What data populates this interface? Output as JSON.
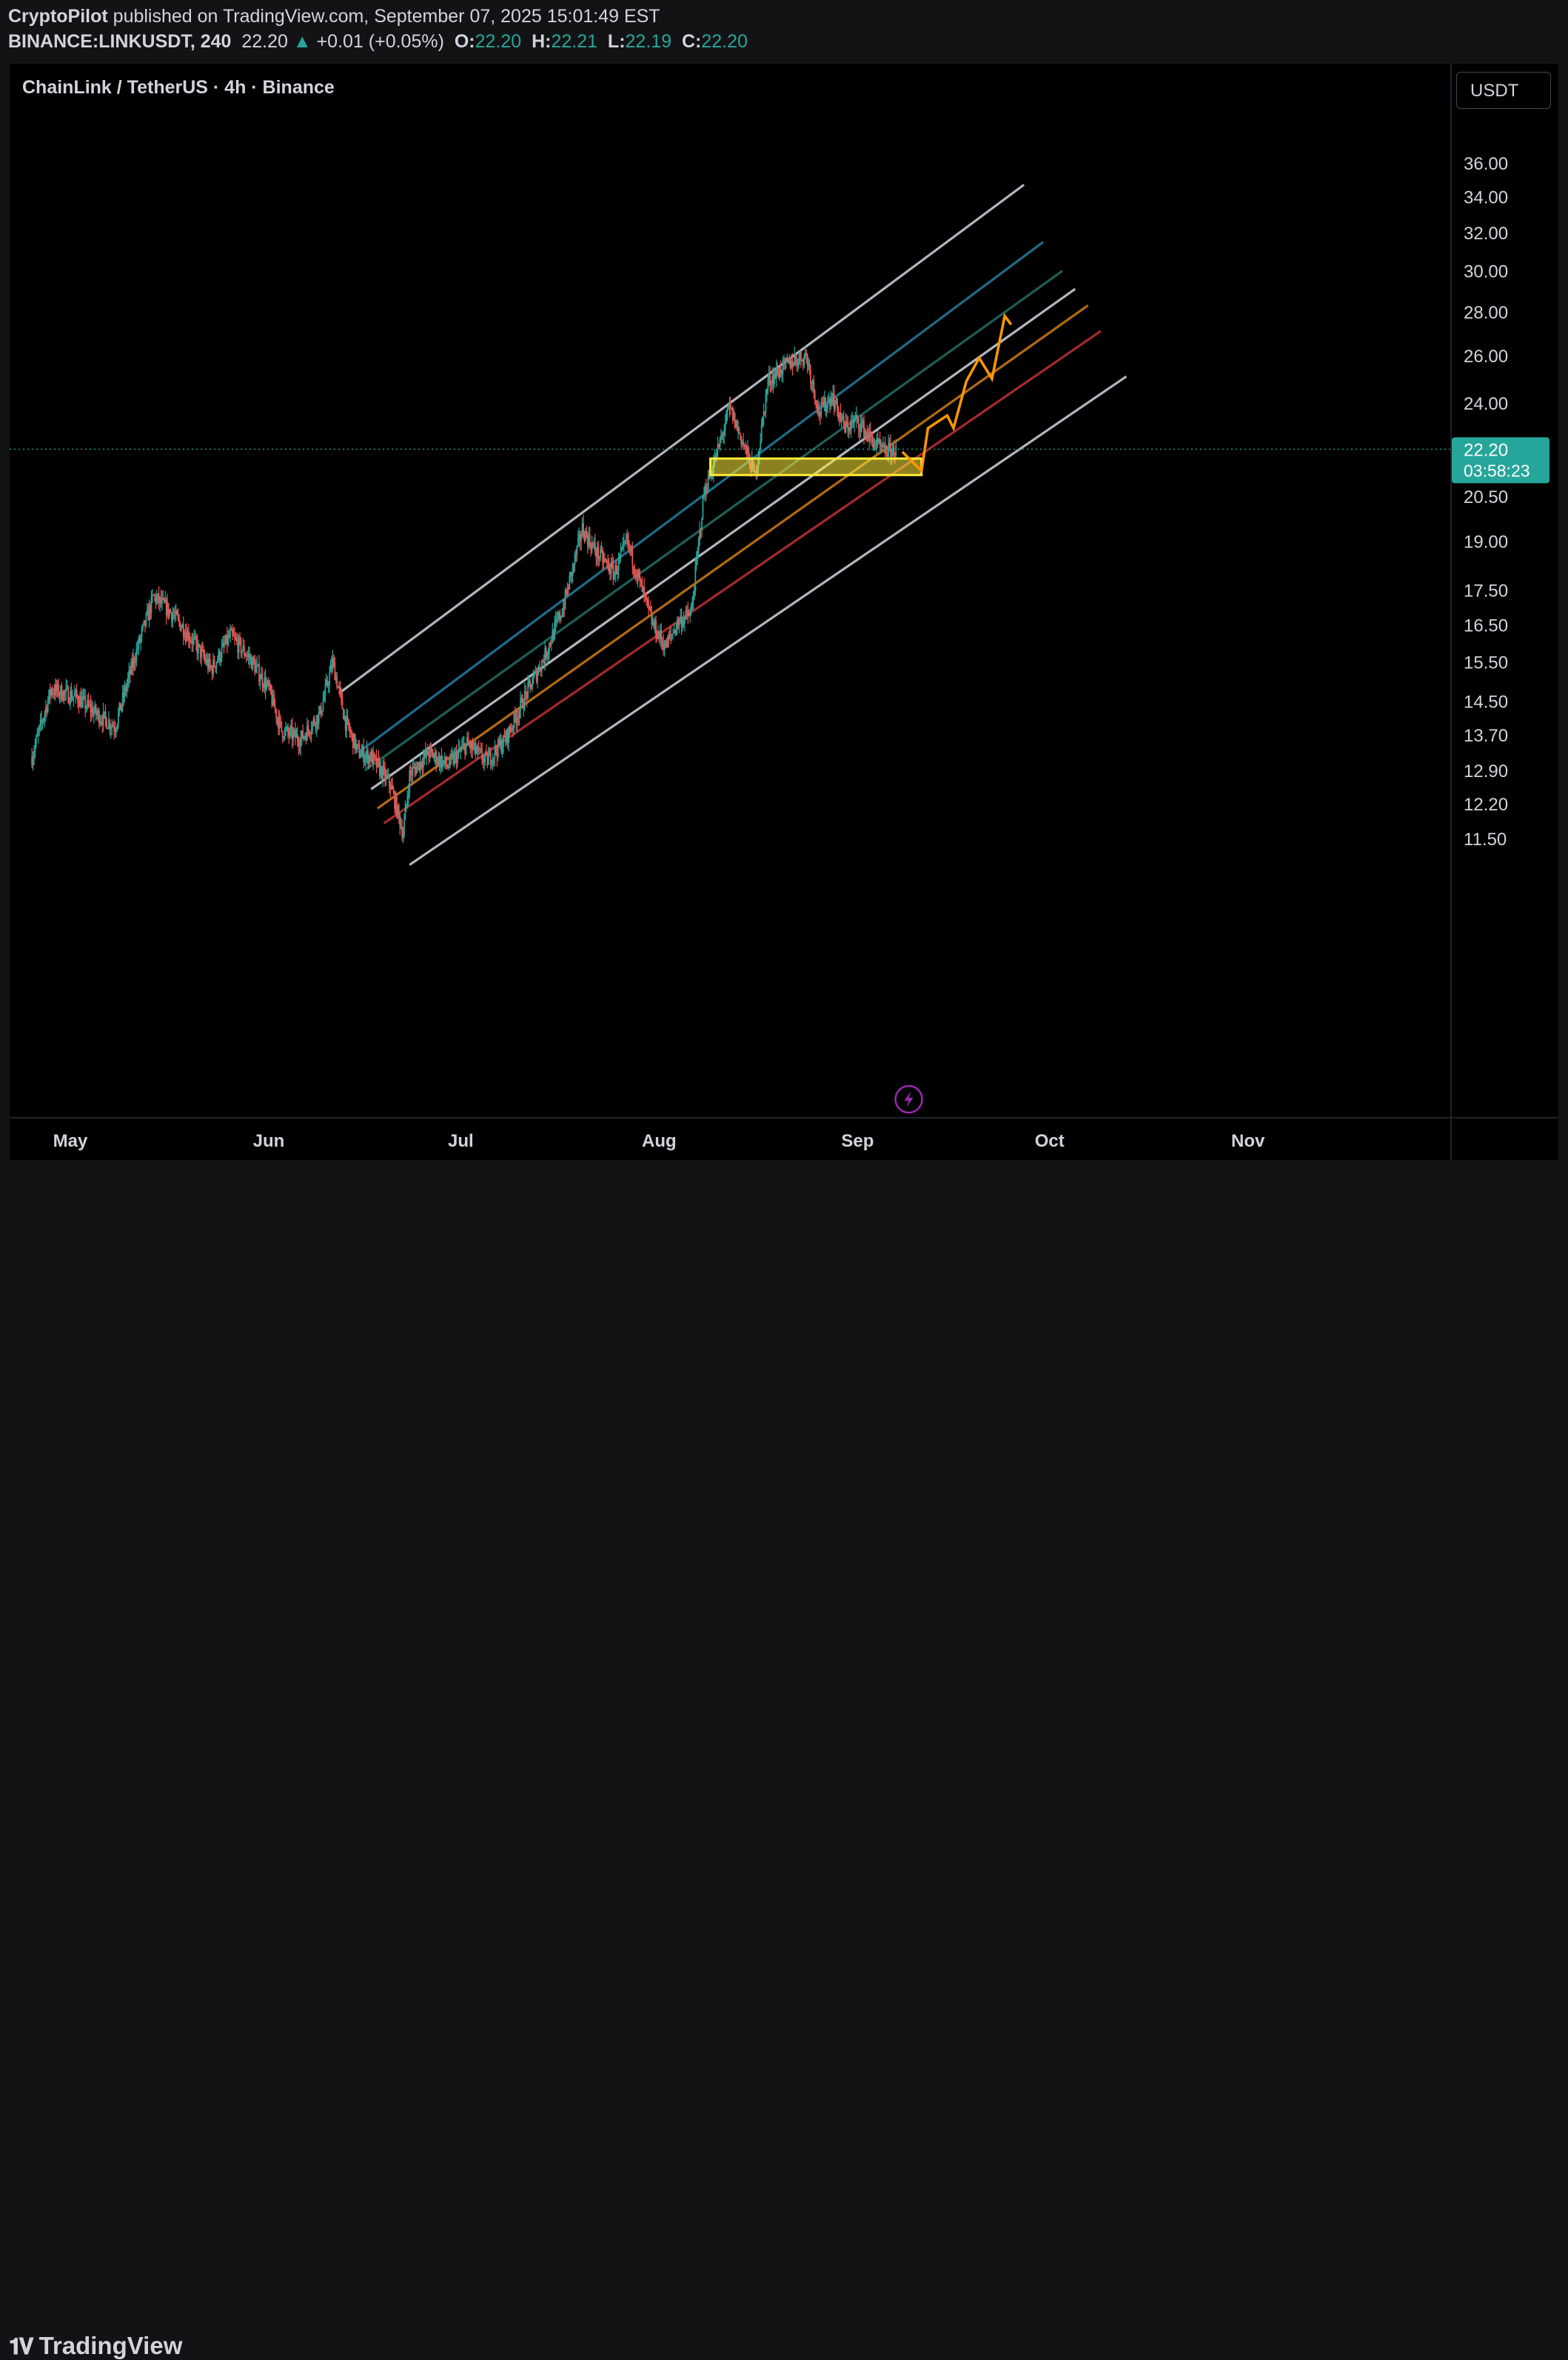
{
  "header": {
    "author": "CryptoPilot",
    "published_text": " published on TradingView.com, September 07, 2025 15:01:49 EST",
    "symbol": "BINANCE:LINKUSDT, 240",
    "last": "22.20",
    "change": "+0.01 (+0.05%)",
    "o_label": "O:",
    "o_value": "22.20",
    "h_label": "H:",
    "h_value": "22.21",
    "l_label": "L:",
    "l_value": "22.19",
    "c_label": "C:",
    "c_value": "22.20"
  },
  "chart_title": "ChainLink / TetherUS · 4h · Binance",
  "currency_button": "USDT",
  "price_badge": {
    "price": "22.20",
    "countdown": "03:58:23"
  },
  "footer": {
    "brand": "TradingView"
  },
  "colors": {
    "up": "#26a69a",
    "down": "#ef5350",
    "background": "#000000",
    "channel_outer": "#b2b5be",
    "channel_blue": "#1f6b8a",
    "channel_teal": "#1e5e58",
    "channel_orange": "#b26b12",
    "channel_red": "#a52a2a",
    "projection": "#ff9800",
    "zone": "#ffeb3b"
  },
  "chart_data": {
    "type": "candlestick",
    "title": "ChainLink / TetherUS · 4h · Binance",
    "interval": "4h",
    "y_scale": "log",
    "y_ticks": [
      "36.00",
      "34.00",
      "32.00",
      "30.00",
      "28.00",
      "26.00",
      "24.00",
      "20.50",
      "19.00",
      "17.50",
      "16.50",
      "15.50",
      "14.50",
      "13.70",
      "12.90",
      "12.20",
      "11.50"
    ],
    "x_ticks": [
      "May",
      "Jun",
      "Jul",
      "Aug",
      "Sep",
      "Oct",
      "Nov"
    ],
    "last_price": 22.2,
    "close_path": [
      [
        "2025-04-25",
        13.2
      ],
      [
        "2025-04-28",
        14.8
      ],
      [
        "2025-05-02",
        14.6
      ],
      [
        "2025-05-05",
        14.2
      ],
      [
        "2025-05-08",
        13.9
      ],
      [
        "2025-05-11",
        15.6
      ],
      [
        "2025-05-14",
        17.3
      ],
      [
        "2025-05-17",
        16.8
      ],
      [
        "2025-05-20",
        16.1
      ],
      [
        "2025-05-23",
        15.3
      ],
      [
        "2025-05-26",
        16.2
      ],
      [
        "2025-05-29",
        15.6
      ],
      [
        "2025-06-01",
        14.8
      ],
      [
        "2025-06-03",
        13.8
      ],
      [
        "2025-06-06",
        13.6
      ],
      [
        "2025-06-09",
        14.2
      ],
      [
        "2025-06-11",
        15.5
      ],
      [
        "2025-06-13",
        14.0
      ],
      [
        "2025-06-15",
        13.3
      ],
      [
        "2025-06-17",
        13.2
      ],
      [
        "2025-06-20",
        12.6
      ],
      [
        "2025-06-22",
        11.6
      ],
      [
        "2025-06-23",
        12.8
      ],
      [
        "2025-06-26",
        13.3
      ],
      [
        "2025-06-29",
        13.0
      ],
      [
        "2025-07-02",
        13.5
      ],
      [
        "2025-07-05",
        13.1
      ],
      [
        "2025-07-08",
        13.6
      ],
      [
        "2025-07-11",
        14.6
      ],
      [
        "2025-07-14",
        15.6
      ],
      [
        "2025-07-17",
        17.0
      ],
      [
        "2025-07-20",
        19.4
      ],
      [
        "2025-07-22",
        18.7
      ],
      [
        "2025-07-25",
        18.0
      ],
      [
        "2025-07-27",
        19.0
      ],
      [
        "2025-07-29",
        17.7
      ],
      [
        "2025-07-31",
        16.5
      ],
      [
        "2025-08-02",
        15.9
      ],
      [
        "2025-08-04",
        16.6
      ],
      [
        "2025-08-06",
        16.8
      ],
      [
        "2025-08-08",
        20.6
      ],
      [
        "2025-08-10",
        22.0
      ],
      [
        "2025-08-12",
        23.8
      ],
      [
        "2025-08-14",
        22.5
      ],
      [
        "2025-08-16",
        21.2
      ],
      [
        "2025-08-18",
        24.9
      ],
      [
        "2025-08-20",
        25.4
      ],
      [
        "2025-08-22",
        25.8
      ],
      [
        "2025-08-24",
        26.0
      ],
      [
        "2025-08-26",
        23.6
      ],
      [
        "2025-08-28",
        24.3
      ],
      [
        "2025-08-30",
        23.0
      ],
      [
        "2025-09-01",
        23.3
      ],
      [
        "2025-09-03",
        22.6
      ],
      [
        "2025-09-05",
        22.1
      ],
      [
        "2025-09-07",
        22.2
      ]
    ],
    "channels": {
      "outer_upper": [
        [
          "2025-06-12",
          14.7
        ],
        [
          "2025-09-27",
          34.7
        ]
      ],
      "blue": [
        [
          "2025-06-15",
          13.3
        ],
        [
          "2025-09-30",
          31.5
        ]
      ],
      "teal": [
        [
          "2025-06-16",
          12.9
        ],
        [
          "2025-10-03",
          30.0
        ]
      ],
      "outer_mid": [
        [
          "2025-06-17",
          12.5
        ],
        [
          "2025-10-05",
          29.1
        ]
      ],
      "orange": [
        [
          "2025-06-18",
          12.1
        ],
        [
          "2025-10-07",
          28.3
        ]
      ],
      "red": [
        [
          "2025-06-19",
          11.8
        ],
        [
          "2025-10-09",
          27.1
        ]
      ],
      "outer_lower": [
        [
          "2025-06-23",
          11.0
        ],
        [
          "2025-10-13",
          25.1
        ]
      ]
    },
    "support_zone": {
      "from": "2025-08-09",
      "to": "2025-09-11",
      "low": 21.25,
      "high": 21.85
    },
    "projection_path": [
      [
        "2025-09-08",
        22.1
      ],
      [
        "2025-09-11",
        21.4
      ],
      [
        "2025-09-12",
        23.0
      ],
      [
        "2025-09-15",
        23.5
      ],
      [
        "2025-09-16",
        23.0
      ],
      [
        "2025-09-18",
        24.9
      ],
      [
        "2025-09-20",
        25.9
      ],
      [
        "2025-09-22",
        25.0
      ],
      [
        "2025-09-24",
        27.8
      ],
      [
        "2025-09-25",
        27.4
      ]
    ]
  }
}
